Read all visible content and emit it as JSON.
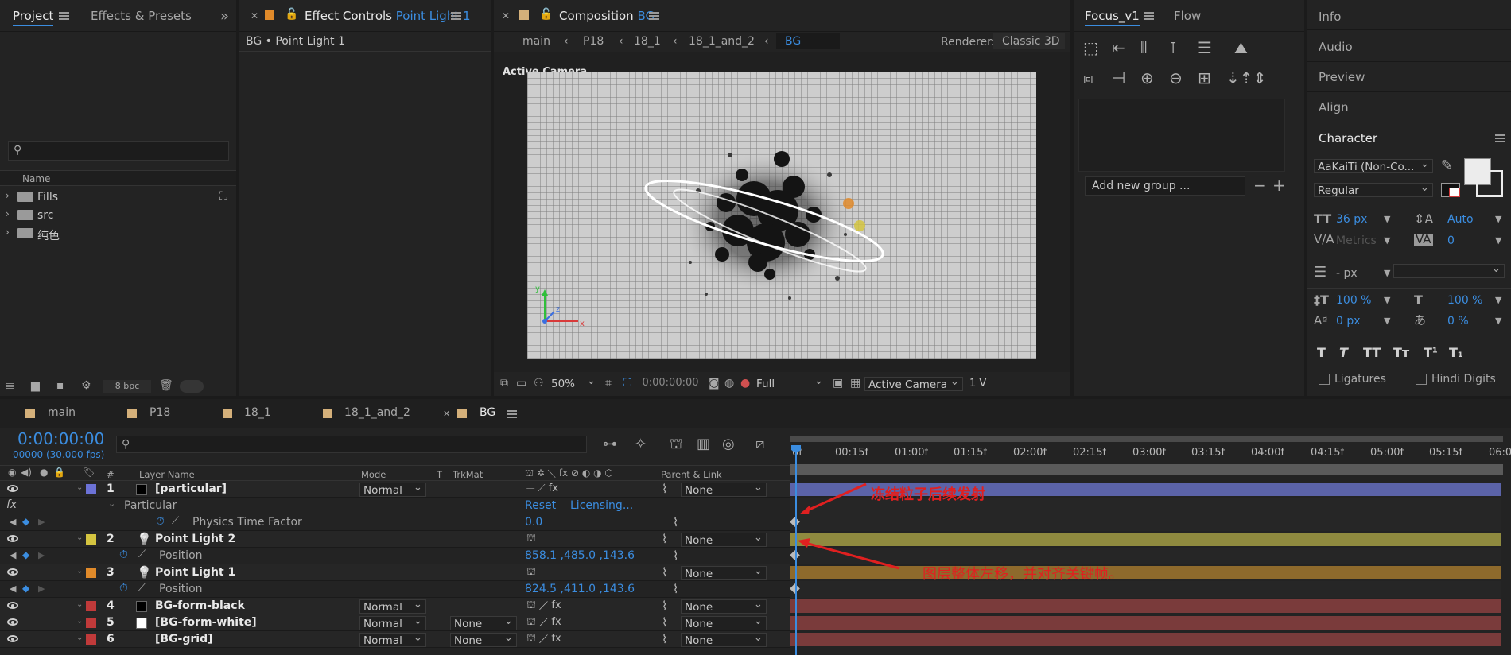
{
  "project": {
    "tab_project": "Project",
    "tab_effects": "Effects & Presets",
    "search_placeholder": "",
    "col_name": "Name",
    "items": [
      {
        "name": "Fills"
      },
      {
        "name": "src"
      },
      {
        "name": "纯色"
      }
    ],
    "bpc": "8 bpc"
  },
  "effect_controls": {
    "title": "Effect Controls",
    "layer": "Point Light 1",
    "breadcrumb": "BG • Point Light 1"
  },
  "composition": {
    "title": "Composition",
    "comp": "BG",
    "crumbs": [
      "main",
      "P18",
      "18_1",
      "18_1_and_2",
      "BG"
    ],
    "renderer_label": "Renderer:",
    "renderer": "Classic 3D",
    "active_camera_label": "Active Camera",
    "zoom": "50%",
    "timecode": "0:00:00:00",
    "resolution": "Full",
    "view": "Active Camera",
    "views_count": "1 V"
  },
  "focus": {
    "tab": "Focus_v1",
    "tab_flow": "Flow",
    "add_group": "Add new group ..."
  },
  "right_panels": {
    "info": "Info",
    "audio": "Audio",
    "preview": "Preview",
    "align": "Align",
    "character": "Character",
    "font": "AaKaiTi (Non-Co...",
    "style": "Regular",
    "size": "36 px",
    "leading": "Auto",
    "kerning": "Metrics",
    "tracking": "0",
    "stroke": "- px",
    "vscale": "100 %",
    "hscale": "100 %",
    "baseline": "0 px",
    "tsume": "0 %",
    "ligatures": "Ligatures",
    "hindi": "Hindi Digits",
    "fmt_buttons": [
      "T",
      "T",
      "TT",
      "Tт",
      "T¹",
      "T₁"
    ]
  },
  "timeline": {
    "tabs": [
      "main",
      "P18",
      "18_1",
      "18_1_and_2",
      "BG"
    ],
    "timecode": "0:00:00:00",
    "frames": "00000 (30.000 fps)",
    "col_layer": "Layer Name",
    "col_mode": "Mode",
    "col_t": "T",
    "col_trkmat": "TrkMat",
    "col_parent": "Parent & Link",
    "ruler": [
      "0f",
      "00:15f",
      "01:00f",
      "01:15f",
      "02:00f",
      "02:15f",
      "03:00f",
      "03:15f",
      "04:00f",
      "04:15f",
      "05:00f",
      "05:15f",
      "06:0"
    ],
    "layers": [
      {
        "num": "1",
        "name": "[particular]",
        "mode": "Normal",
        "trkmat": "",
        "parent": "None",
        "color": "#6c72d6",
        "swatch": "#000000",
        "bar": "#5b63a8"
      },
      {
        "num": "2",
        "name": "Point Light 2",
        "mode": "",
        "trkmat": "",
        "parent": "None",
        "color": "#d4c440",
        "swatch": "",
        "bar": "#8f8a3f"
      },
      {
        "num": "3",
        "name": "Point Light 1",
        "mode": "",
        "trkmat": "",
        "parent": "None",
        "color": "#e08a2a",
        "swatch": "",
        "bar": "#8e6a2c"
      },
      {
        "num": "4",
        "name": "BG-form-black",
        "mode": "Normal",
        "trkmat": "",
        "parent": "None",
        "color": "#c03a3a",
        "swatch": "#000000",
        "bar": "#7a3b3b"
      },
      {
        "num": "5",
        "name": "[BG-form-white]",
        "mode": "Normal",
        "trkmat": "None",
        "parent": "None",
        "color": "#c03a3a",
        "swatch": "#ffffff",
        "bar": "#7a3b3b"
      },
      {
        "num": "6",
        "name": "[BG-grid]",
        "mode": "Normal",
        "trkmat": "None",
        "parent": "None",
        "color": "#c03a3a",
        "swatch": "",
        "bar": "#7a3b3b"
      }
    ],
    "particular_effect": "Particular",
    "reset": "Reset",
    "licensing": "Licensing...",
    "physics_label": "Physics Time Factor",
    "physics_value": "0.0",
    "position_label": "Position",
    "pl2_position": "858.1 ,485.0 ,143.6",
    "pl1_position": "824.5 ,411.0 ,143.6",
    "annotation1": "冻结粒子后续发射",
    "annotation2": "图层整体左移，并对齐关键帧。"
  }
}
